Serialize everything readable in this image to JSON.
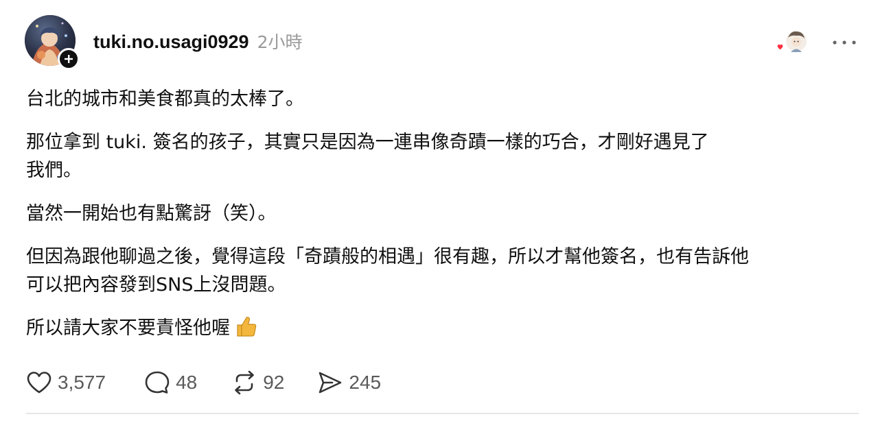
{
  "post": {
    "author": {
      "username": "tuki.no.usagi0929",
      "timestamp": "2小時"
    },
    "icons": {
      "avatar": "user-avatar",
      "follow": "plus-icon",
      "likers": "liker-avatars",
      "more": "ellipsis-icon"
    },
    "body": {
      "p1": "台北的城市和美食都真的太棒了。",
      "p2_line1": "那位拿到 tuki. 簽名的孩子，其實只是因為一連串像奇蹟一樣的巧合，才剛好遇見了",
      "p2_line2": "我們。",
      "p3": "當然一開始也有點驚訝（笑）。",
      "p4_line1": "但因為跟他聊過之後，覺得這段「奇蹟般的相遇」很有趣，所以才幫他簽名，也有告訴他",
      "p4_line2": "可以把內容發到SNS上沒問題。",
      "p5": "所以請大家不要責怪他喔",
      "p5_emoji": "thumbs-up"
    },
    "actions": {
      "likes": "3,577",
      "comments": "48",
      "reposts": "92",
      "shares": "245"
    },
    "colors": {
      "text": "#101010",
      "muted": "#999999",
      "count": "#5a5a5a",
      "heart": "#ff3040",
      "thumb": "#f4b73d"
    }
  }
}
